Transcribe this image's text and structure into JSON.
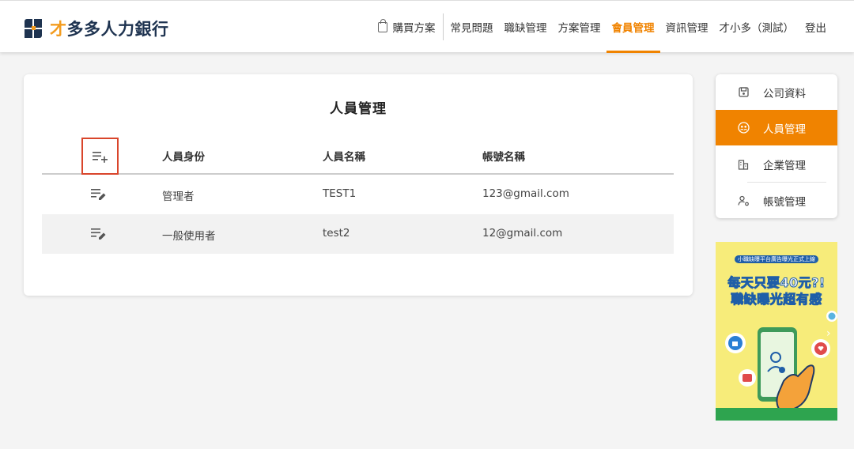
{
  "header": {
    "logo_prefix": "才",
    "logo_rest": "多多人力銀行",
    "nav": [
      {
        "label": "購買方案",
        "active": false
      },
      {
        "label": "常見問題",
        "active": false
      },
      {
        "label": "職缺管理",
        "active": false
      },
      {
        "label": "方案管理",
        "active": false
      },
      {
        "label": "會員管理",
        "active": true
      },
      {
        "label": "資訊管理",
        "active": false
      },
      {
        "label": "才小多（測試）",
        "active": false
      },
      {
        "label": "登出",
        "active": false
      }
    ]
  },
  "main": {
    "title": "人員管理",
    "columns": [
      "人員身份",
      "人員名稱",
      "帳號名稱"
    ],
    "rows": [
      {
        "role": "管理者",
        "name": "TEST1",
        "account": "123@gmail.com"
      },
      {
        "role": "一般使用者",
        "name": "test2",
        "account": "12@gmail.com"
      }
    ]
  },
  "side_menu": {
    "items": [
      {
        "label": "公司資料",
        "icon": "save-icon",
        "active": false
      },
      {
        "label": "人員管理",
        "icon": "people-icon",
        "active": true
      },
      {
        "label": "企業管理",
        "icon": "building-icon",
        "active": false
      },
      {
        "label": "帳號管理",
        "icon": "user-gear-icon",
        "active": false
      }
    ]
  },
  "ad": {
    "top_text": "小職缺曝平台廣告曝光正式上線",
    "line1": "每天只要40元?!",
    "line2": "職缺曝光超有感"
  },
  "colors": {
    "accent": "#f08300",
    "navy": "#1e3350",
    "highlight_border": "#d9452b",
    "ad_bg": "#f7ec7a"
  }
}
